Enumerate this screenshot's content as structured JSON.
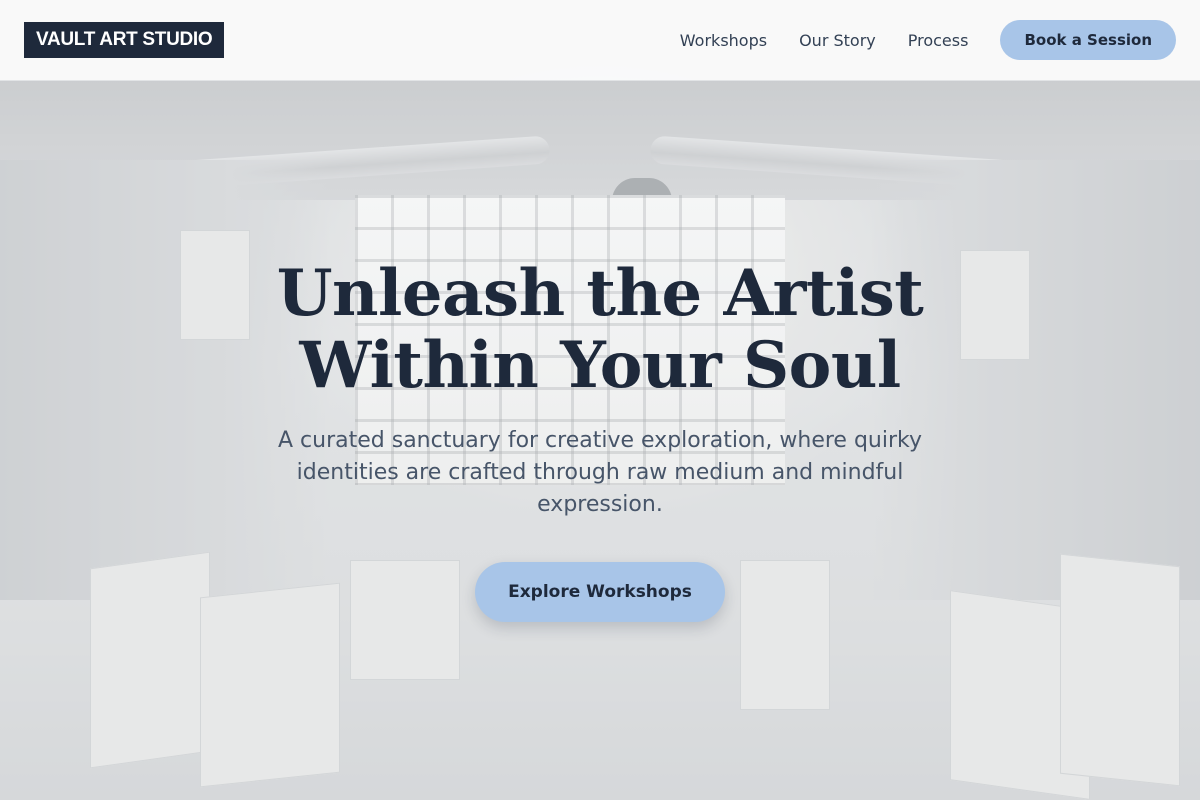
{
  "brand": {
    "logo_text": "VAULT ART STUDIO"
  },
  "nav": {
    "links": [
      "Workshops",
      "Our Story",
      "Process"
    ],
    "cta_label": "Book a Session"
  },
  "hero": {
    "headline_line1": "Unleash the Artist",
    "headline_line2": "Within Your Soul",
    "subtitle": "A curated sanctuary for creative exploration, where quirky identities are crafted through raw medium and mindful expression.",
    "cta_label": "Explore Workshops",
    "background_image": "studio-interior-photo"
  },
  "colors": {
    "navy": "#1e293b",
    "accent": "#a8c5e8",
    "body_text": "#475569"
  }
}
